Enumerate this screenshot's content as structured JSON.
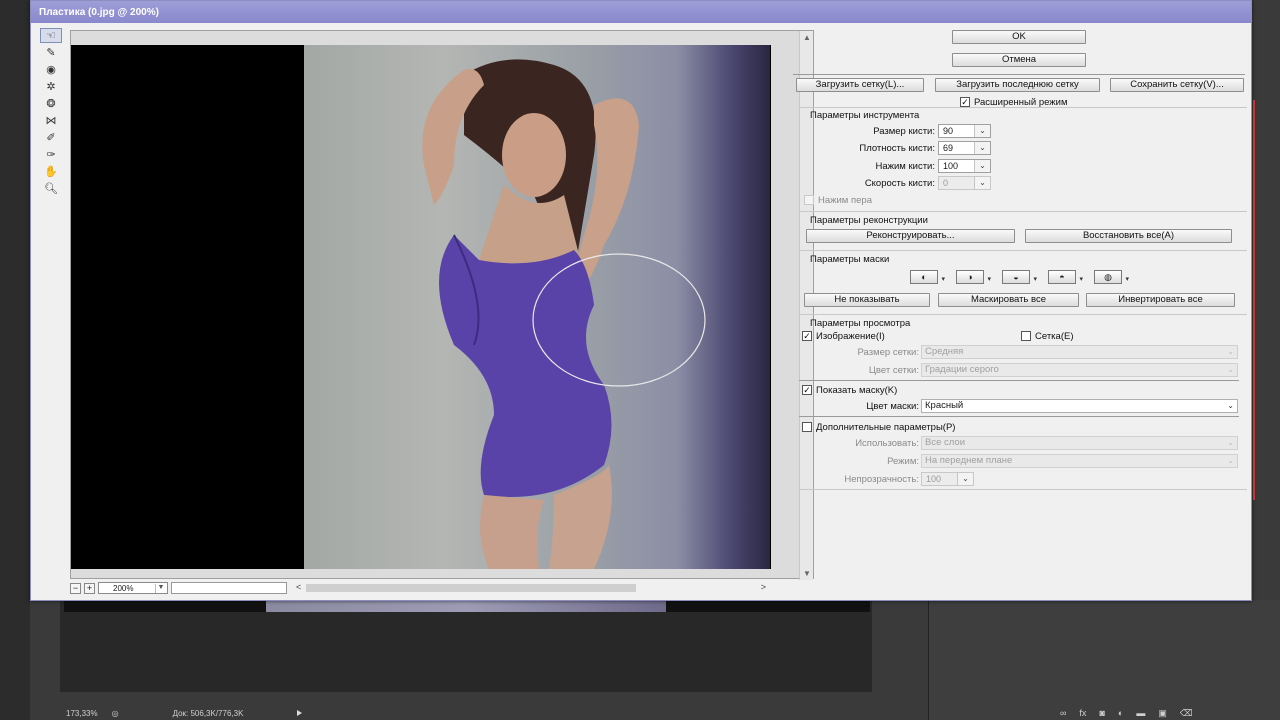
{
  "dialog": {
    "title": "Пластика (0.jpg @ 200%)",
    "ok": "OK",
    "cancel": "Отмена"
  },
  "tools": [
    "forward-warp-tool",
    "reconstruct-tool",
    "twirl-tool",
    "pucker-tool",
    "bloat-tool",
    "push-left-tool",
    "freeze-mask-tool",
    "thaw-mask-tool",
    "hand-tool",
    "zoom-tool"
  ],
  "mesh": {
    "load": "Загрузить сетку(L)...",
    "load_last": "Загрузить последнюю сетку",
    "save": "Сохранить сетку(V)...",
    "advanced": "Расширенный режим"
  },
  "tool_options": {
    "title": "Параметры инструмента",
    "brush_size_label": "Размер кисти:",
    "brush_size": "90",
    "brush_density_label": "Плотность кисти:",
    "brush_density": "69",
    "brush_pressure_label": "Нажим кисти:",
    "brush_pressure": "100",
    "brush_rate_label": "Скорость кисти:",
    "brush_rate": "0",
    "stylus_pressure": "Нажим пера"
  },
  "reconstruct": {
    "title": "Параметры реконструкции",
    "reconstruct_btn": "Реконструировать...",
    "restore_all": "Восстановить все(А)"
  },
  "mask": {
    "title": "Параметры маски",
    "none": "Не показывать",
    "mask_all": "Маскировать все",
    "invert_all": "Инвертировать все"
  },
  "view": {
    "title": "Параметры просмотра",
    "image": "Изображение(I)",
    "mesh": "Сетка(E)",
    "mesh_size_label": "Размер сетки:",
    "mesh_size": "Средняя",
    "mesh_color_label": "Цвет сетки:",
    "mesh_color": "Градации серого",
    "show_mask": "Показать маску(K)",
    "mask_color_label": "Цвет маски:",
    "mask_color": "Красный",
    "extras": "Дополнительные параметры(P)",
    "use_label": "Использовать:",
    "use": "Все слои",
    "mode_label": "Режим:",
    "mode": "На переднем плане",
    "opacity_label": "Непрозрачность:",
    "opacity": "100"
  },
  "zoom": {
    "value": "200%",
    "minus": "−",
    "plus": "+"
  },
  "status": {
    "zoom": "173,33%",
    "doc": "Док: 506,3K/776,3K"
  },
  "colors": {
    "title_bar": "#8888cc",
    "swimsuit": "#5a43a8"
  }
}
